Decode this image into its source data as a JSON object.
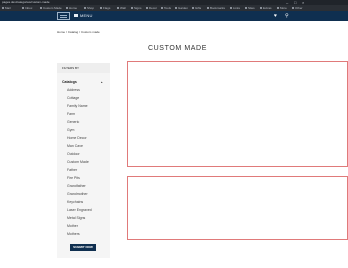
{
  "browser": {
    "url_text": "pages.dev/categories/custom-made",
    "bookmarks": [
      "Mail",
      "Inbox",
      "Custom Made",
      "Home",
      "Shop",
      "Flags",
      "Wall",
      "Signs",
      "Decor",
      "Tools",
      "Garden",
      "Gifts",
      "Bookmarks",
      "Links",
      "Sites",
      "Extras",
      "More",
      "Other"
    ]
  },
  "nav": {
    "menu_label": "MENU",
    "heart_glyph": "♥",
    "search_glyph": "⚲"
  },
  "breadcrumb": [
    "Home",
    "Catalog",
    "Custom made"
  ],
  "page_title": "CUSTOM MADE",
  "filters": {
    "header": "FILTERS BY",
    "group_label": "Catalogs",
    "caret": "▴",
    "categories": [
      "Address",
      "Cottage",
      "Family Name",
      "Farm",
      "Generic",
      "Gym",
      "Home Decor",
      "Man Cave",
      "Outdoor",
      "Custom Made",
      "Father",
      "Fire Pits",
      "Grandfather",
      "Grandmother",
      "Keychains",
      "Laser Engraved",
      "Metal Signs",
      "Mother",
      "Mothers"
    ],
    "submit_label": "SUBMIT NOW"
  }
}
